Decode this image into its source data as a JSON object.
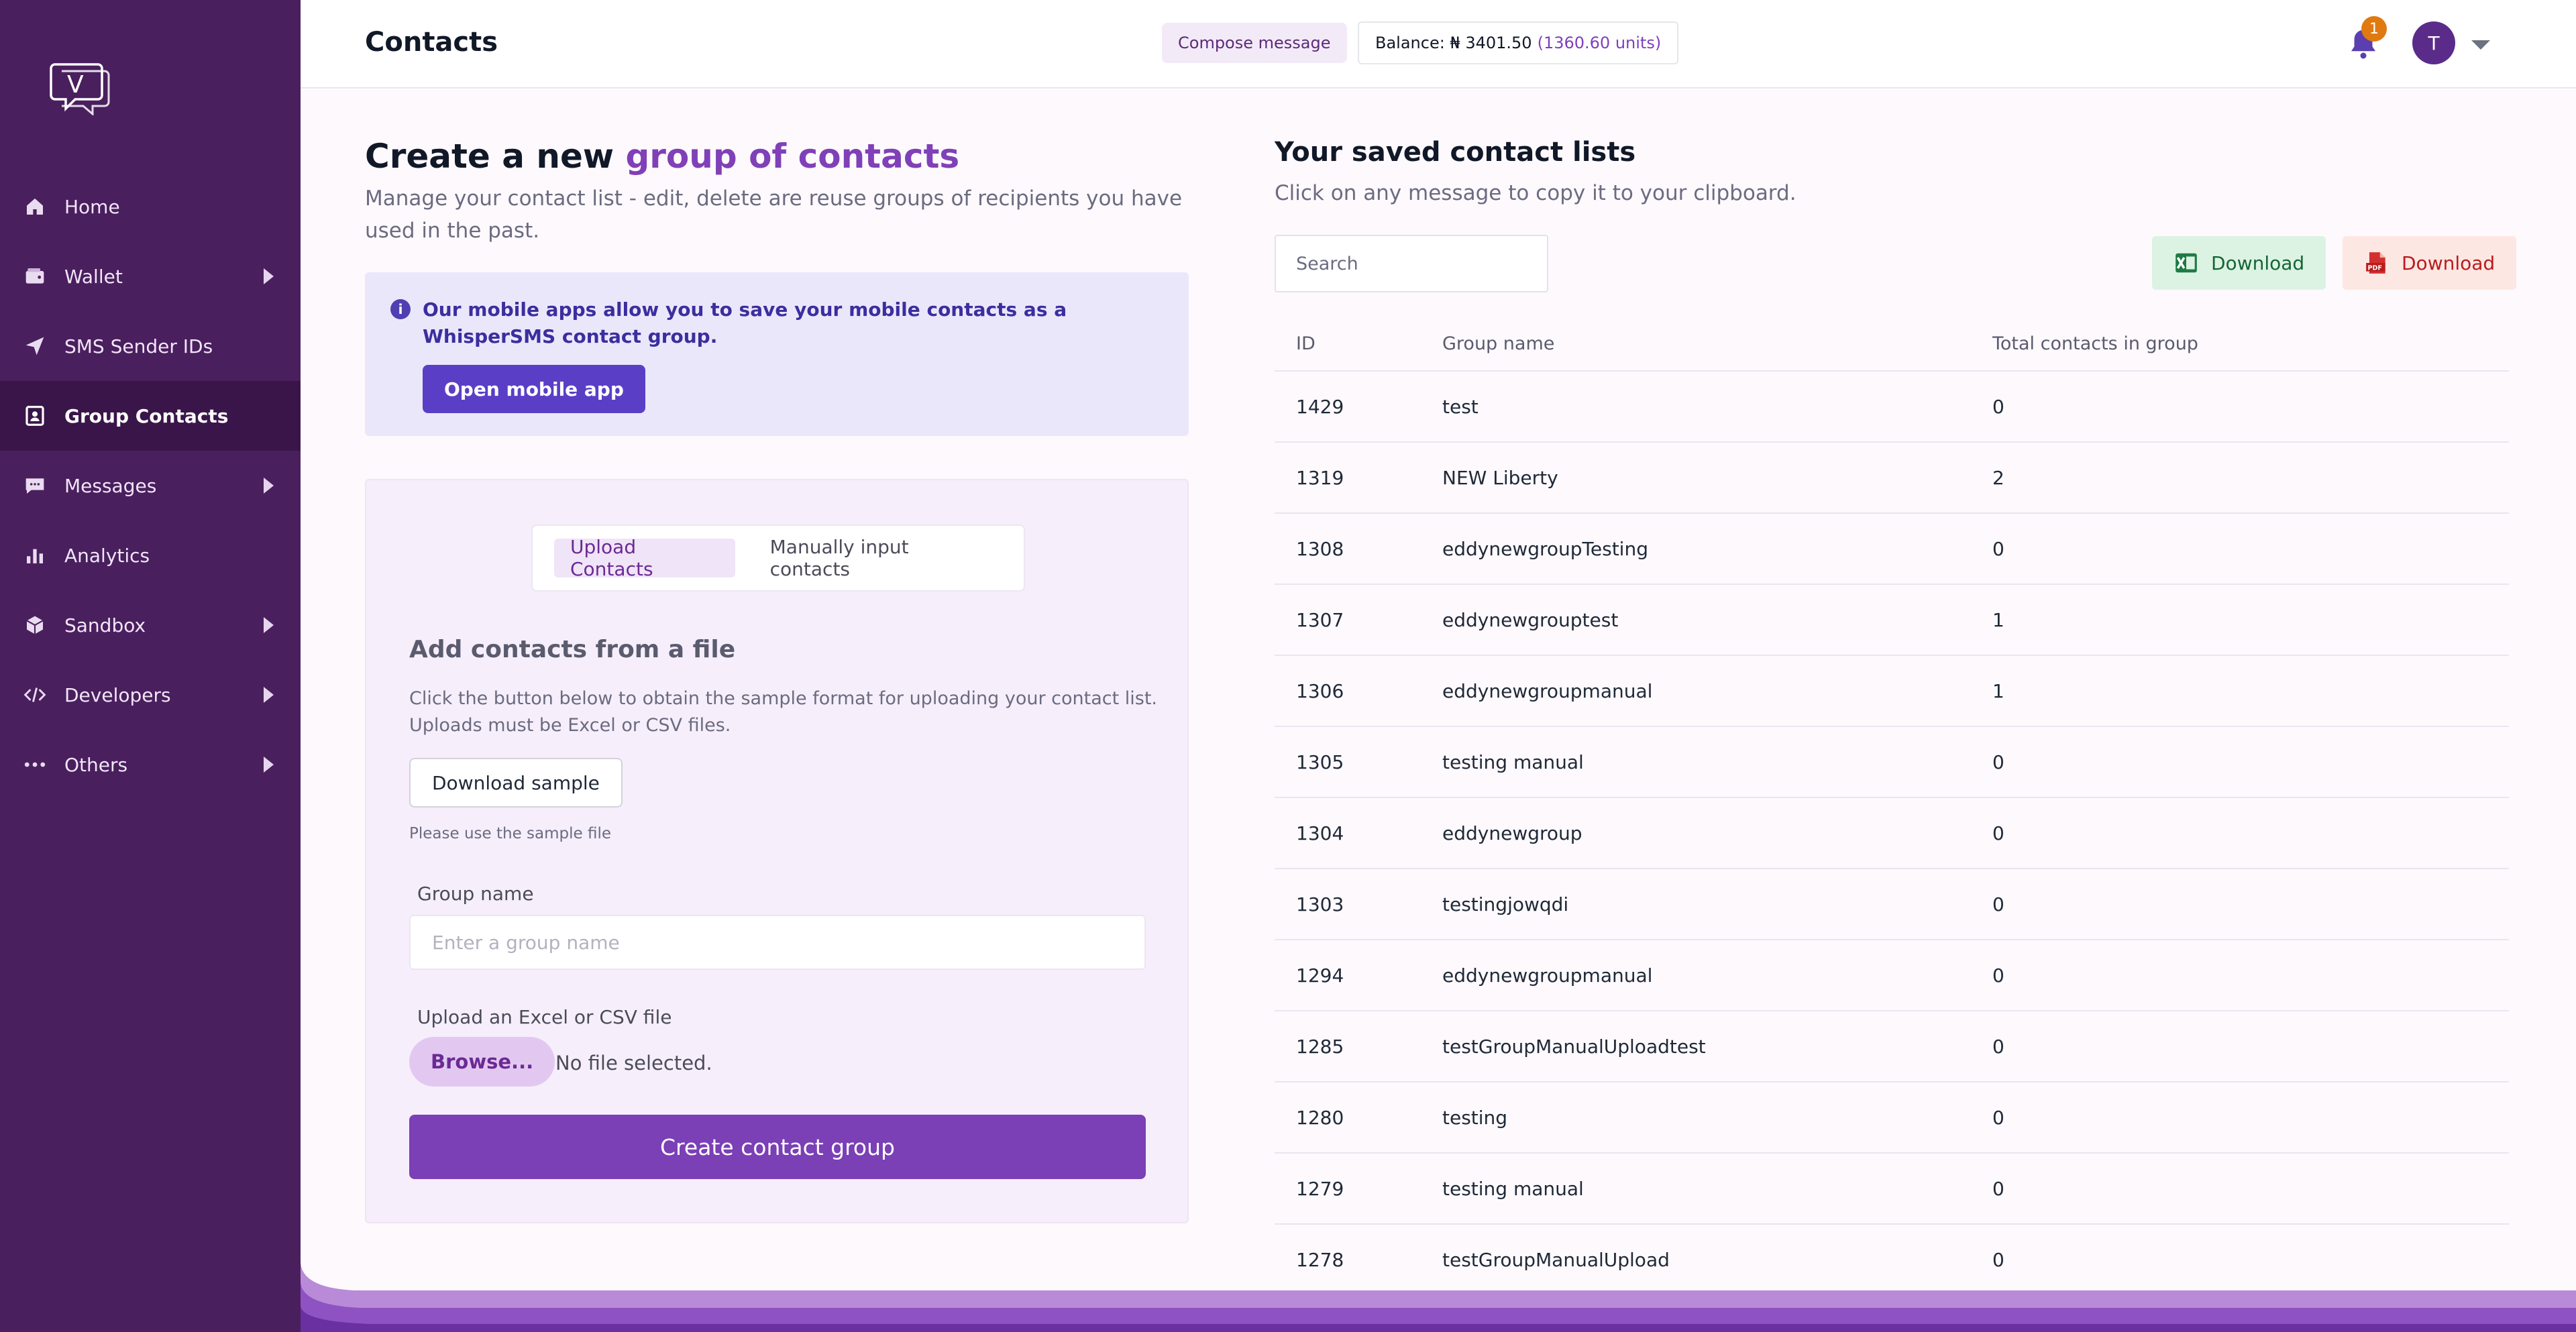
{
  "app": {
    "logo_letter": "V"
  },
  "sidebar": {
    "items": [
      {
        "label": "Home",
        "icon": "home-icon",
        "has_submenu": false,
        "active": false
      },
      {
        "label": "Wallet",
        "icon": "wallet-icon",
        "has_submenu": true,
        "active": false
      },
      {
        "label": "SMS Sender IDs",
        "icon": "send-icon",
        "has_submenu": false,
        "active": false
      },
      {
        "label": "Group Contacts",
        "icon": "contacts-icon",
        "has_submenu": false,
        "active": true
      },
      {
        "label": "Messages",
        "icon": "message-icon",
        "has_submenu": true,
        "active": false
      },
      {
        "label": "Analytics",
        "icon": "analytics-icon",
        "has_submenu": false,
        "active": false
      },
      {
        "label": "Sandbox",
        "icon": "sandbox-icon",
        "has_submenu": true,
        "active": false
      },
      {
        "label": "Developers",
        "icon": "code-icon",
        "has_submenu": true,
        "active": false
      },
      {
        "label": "Others",
        "icon": "more-icon",
        "has_submenu": true,
        "active": false
      }
    ]
  },
  "header": {
    "title": "Contacts",
    "compose_label": "Compose message",
    "balance_label": "Balance: ₦ 3401.50",
    "balance_units": "(1360.60 units)",
    "notification_count": "1",
    "avatar_initial": "T"
  },
  "create": {
    "title_prefix": "Create a new ",
    "title_accent": "group of contacts",
    "subtitle": "Manage your contact list - edit, delete are reuse groups of recipients you have used in the past.",
    "info_text": "Our mobile apps allow you to save your mobile contacts as a WhisperSMS contact group.",
    "mobile_button": "Open mobile app",
    "tabs": [
      {
        "label": "Upload Contacts",
        "active": true
      },
      {
        "label": "Manually input contacts",
        "active": false
      }
    ],
    "file_title": "Add contacts from a file",
    "file_desc": "Click the button below to obtain the sample format for uploading your contact list. Uploads must be Excel or CSV files.",
    "sample_button": "Download sample",
    "sample_hint": "Please use the sample file",
    "group_label": "Group name",
    "group_placeholder": "Enter a group name",
    "upload_label": "Upload an Excel or CSV file",
    "browse_button": "Browse...",
    "no_file": "No file selected.",
    "create_button": "Create contact group"
  },
  "saved": {
    "title": "Your saved contact lists",
    "subtitle": "Click on any message to copy it to your clipboard.",
    "search_placeholder": "Search",
    "download_excel": "Download",
    "download_pdf": "Download",
    "columns": [
      "ID",
      "Group name",
      "Total contacts in group"
    ],
    "rows": [
      {
        "id": "1429",
        "name": "test",
        "total": "0"
      },
      {
        "id": "1319",
        "name": "NEW Liberty",
        "total": "2"
      },
      {
        "id": "1308",
        "name": "eddynewgroupTesting",
        "total": "0"
      },
      {
        "id": "1307",
        "name": "eddynewgrouptest",
        "total": "1"
      },
      {
        "id": "1306",
        "name": "eddynewgroupmanual",
        "total": "1"
      },
      {
        "id": "1305",
        "name": "testing manual",
        "total": "0"
      },
      {
        "id": "1304",
        "name": "eddynewgroup",
        "total": "0"
      },
      {
        "id": "1303",
        "name": "testingjowqdi",
        "total": "0"
      },
      {
        "id": "1294",
        "name": "eddynewgroupmanual",
        "total": "0"
      },
      {
        "id": "1285",
        "name": "testGroupManualUploadtest",
        "total": "0"
      },
      {
        "id": "1280",
        "name": "testing",
        "total": "0"
      },
      {
        "id": "1279",
        "name": "testing manual",
        "total": "0"
      },
      {
        "id": "1278",
        "name": "testGroupManualUpload",
        "total": "0"
      }
    ]
  },
  "colors": {
    "sidebar_bg": "#4a1f5e",
    "accent": "#7b3fb6",
    "info_bg": "#ebe7fb",
    "excel_green": "#166534",
    "pdf_red": "#b91c1c",
    "badge_orange": "#e07a10"
  }
}
